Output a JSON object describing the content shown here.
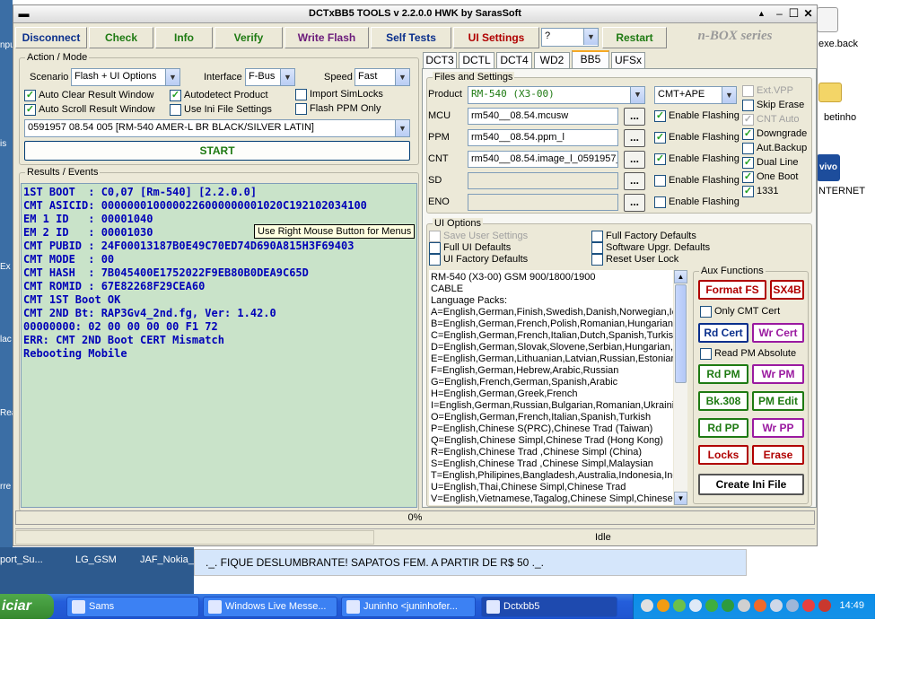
{
  "window": {
    "title": "DCTxBB5 TOOLS v 2.2.0.0 HWK by SarasSoft"
  },
  "toolbar": {
    "disconnect": "Disconnect",
    "check": "Check",
    "info": "Info",
    "verify": "Verify",
    "write_flash": "Write Flash",
    "self_tests": "Self Tests",
    "ui_settings": "UI Settings",
    "help_select": "?",
    "restart": "Restart",
    "brand": "n-BOX series"
  },
  "action_mode": {
    "label": "Action / Mode",
    "scenario_label": "Scenario",
    "scenario_value": "Flash + UI Options",
    "interface_label": "Interface",
    "interface_value": "F-Bus",
    "speed_label": "Speed",
    "speed_value": "Fast",
    "auto_clear": "Auto Clear Result Window",
    "autodetect": "Autodetect Product",
    "import_simlocks": "Import SimLocks",
    "auto_scroll": "Auto Scroll Result Window",
    "use_ini": "Use Ini File Settings",
    "flash_ppm": "Flash PPM Only",
    "product_select": "0591957 08.54 005  [RM-540 AMER-L BR BLACK/SILVER LATIN]",
    "start": "START"
  },
  "results": {
    "label": "Results / Events",
    "lines": [
      "1ST BOOT  : C0,07 [Rm-540] [2.2.0.0]",
      "CMT ASICID: 0000000100000226000000001020C192102034100",
      "EM 1 ID   : 00001040",
      "EM 2 ID   : 00001030",
      "CMT PUBID : 24F00013187B0E49C70ED74D690A815H3F69403",
      "CMT MODE  : 00",
      "CMT HASH  : 7B045400E1752022F9EB80B0DEA9C65D",
      "CMT ROMID : 67E82268F29CEA60",
      "CMT 1ST Boot OK",
      "CMT 2ND Bt: RAP3Gv4_2nd.fg, Ver: 1.42.0",
      "00000000: 02 00 00 00 00 F1 72",
      "ERR: CMT 2ND Boot CERT Mismatch",
      "Rebooting Mobile"
    ],
    "tooltip": "Use Right Mouse Button for Menus"
  },
  "tabs": [
    "DCT3",
    "DCTL",
    "DCT4",
    "WD2",
    "BB5",
    "UFSx"
  ],
  "files": {
    "label": "Files and Settings",
    "product_label": "Product",
    "product_value": "RM-540  (X3-00)",
    "cmt_select": "CMT+APE",
    "mcu_label": "MCU",
    "mcu_value": "rm540__08.54.mcusw",
    "ppm_label": "PPM",
    "ppm_value": "rm540__08.54.ppm_l",
    "cnt_label": "CNT",
    "cnt_value": "rm540__08.54.image_l_0591957_",
    "sd_label": "SD",
    "eno_label": "ENO",
    "browse": "...",
    "enable_flashing": "Enable Flashing",
    "ext_vpp": "Ext.VPP",
    "skip_erase": "Skip Erase",
    "cnt_auto": "CNT Auto",
    "downgrade": "Downgrade",
    "aut_backup": "Aut.Backup",
    "dual_line": "Dual Line",
    "one_boot": "One Boot",
    "n1331": "1331"
  },
  "ui_options": {
    "label": "UI Options",
    "save_user": "Save User Settings",
    "full_factory": "Full Factory Defaults",
    "full_ui": "Full UI Defaults",
    "software_upgr": "Software Upgr. Defaults",
    "ui_factory": "UI Factory Defaults",
    "reset_user_lock": "Reset User Lock",
    "info_lines": [
      "     RM-540 (X3-00) GSM 900/1800/1900",
      "CABLE",
      "Language Packs:",
      "A=English,German,Finish,Swedish,Danish,Norwegian,Icel",
      "B=English,German,French,Polish,Romanian,Hungarian",
      "C=English,German,French,Italian,Dutch,Spanish,Turkish,I",
      "D=English,German,Slovak,Slovene,Serbian,Hungarian,C",
      "E=English,German,Lithuanian,Latvian,Russian,Estonian",
      "F=English,German,Hebrew,Arabic,Russian",
      "G=English,French,German,Spanish,Arabic",
      "H=English,German,Greek,French",
      "I=English,German,Russian,Bulgarian,Romanian,Ukrainian",
      "O=English,German,French,Italian,Spanish,Turkish",
      "P=English,Chinese S(PRC),Chinese Trad (Taiwan)",
      "Q=English,Chinese Simpl,Chinese Trad (Hong Kong)",
      "R=English,Chinese Trad ,Chinese Simpl (China)",
      "S=English,Chinese Trad ,Chinese Simpl,Malaysian",
      "T=English,Philipines,Bangladesh,Australia,Indonesia,India",
      "U=English,Thai,Chinese Simpl,Chinese Trad",
      "V=English,Vietnamese,Tagalog,Chinese Simpl,Chinese Tr"
    ]
  },
  "aux": {
    "label": "Aux Functions",
    "format_fs": "Format FS",
    "sx4b": "SX4B",
    "only_cmt_cert": "Only CMT Cert",
    "rd_cert": "Rd Cert",
    "wr_cert": "Wr Cert",
    "read_pm_absolute": "Read PM Absolute",
    "rd_pm": "Rd PM",
    "wr_pm": "Wr PM",
    "bk308": "Bk.308",
    "pm_edit": "PM Edit",
    "rd_pp": "Rd PP",
    "wr_pp": "Wr PP",
    "locks": "Locks",
    "erase": "Erase",
    "create_ini": "Create Ini File"
  },
  "status": {
    "progress_text": "0%",
    "progress": 0,
    "state": "Idle"
  },
  "desktop": {
    "icons": [
      "exe.back",
      "betinho",
      "NTERNET",
      "port_Su...",
      "LG_GSM",
      "JAF_Nokia_B"
    ],
    "left_labels": [
      "npu",
      "is",
      "Ex",
      "lac",
      "Rea",
      "rre"
    ]
  },
  "banner": {
    "text": "._. FIQUE DESLUMBRANTE! SAPATOS FEM. A PARTIR DE R$ 50 ._."
  },
  "taskbar": {
    "start": "iciar",
    "items": [
      "Sams",
      "Windows Live Messe...",
      "Juninho <juninhofer...",
      "Dctxbb5"
    ],
    "clock": "14:49"
  },
  "colors": {
    "results_bg": "#c9e3c9",
    "results_text": "#0000b8",
    "titlebar": "#e6e6e6",
    "taskbar": "#245edb"
  }
}
